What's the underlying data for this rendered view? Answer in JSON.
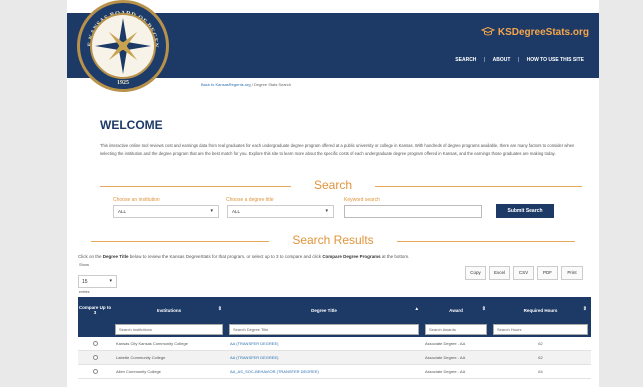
{
  "brand": {
    "name": "KSDegreeStats.org",
    "accent": "#f5a64a",
    "navy": "#1d3a67"
  },
  "seal": {
    "top_text": "THE KANSAS BOARD OF REGENTS",
    "year": "1925",
    "icon": "compass-star-icon"
  },
  "nav": {
    "search": "SEARCH",
    "about": "ABOUT",
    "how": "HOW TO USE THIS SITE",
    "sep": "|"
  },
  "breadcrumb": {
    "home": "Back to KansasRegents.org",
    "sep": "/",
    "current": "Degree Stats Search"
  },
  "welcome": {
    "title": "WELCOME",
    "intro": "This interactive online tool reviews cost and earnings data from real graduates for each undergraduate degree program offered at a public university or college in Kansas. With hundreds of degree programs available, there are many factors to consider when selecting the institution and the degree program that are the best match for you. Explore this site to learn more about the specific costs of each undergraduate degree program offered in Kansas, and the earnings those graduates are making today."
  },
  "search": {
    "title": "Search",
    "institution_label": "Choose an institution",
    "institution_value": "ALL",
    "degree_label": "Choose a degree title",
    "degree_value": "ALL",
    "keyword_label": "Keyword search",
    "keyword_value": "",
    "submit": "Submit Search"
  },
  "results": {
    "title": "Search Results",
    "help_pre": "Click on the ",
    "help_bold1": "Degree Title",
    "help_mid": " below to review the Kansas DegreeStats for that program, or select up to 3 to compare and click ",
    "help_bold2": "Compare Degree Programs",
    "help_post": " at the bottom.",
    "show_label": "Show",
    "entries_value": "15",
    "entries_label": "entries",
    "buttons": [
      "Copy",
      "Excel",
      "CSV",
      "PDF",
      "Print"
    ]
  },
  "table": {
    "columns": [
      {
        "label": "Compare Up to 3"
      },
      {
        "label": "Institutions"
      },
      {
        "label": "Degree Title"
      },
      {
        "label": "Award"
      },
      {
        "label": "Required Hours"
      }
    ],
    "filters": [
      "Search Institutions",
      "Search Degree Title",
      "Search Awards",
      "Search Hours"
    ],
    "rows": [
      {
        "institution": "Kansas City Kansas Community College",
        "degree": "AA (TRANSFER DEGREE)",
        "award": "Associate Degree - AA",
        "hours": "62"
      },
      {
        "institution": "Labette Community College",
        "degree": "AA (TRANSFER DEGREE)",
        "award": "Associate Degree - AA",
        "hours": "62"
      },
      {
        "institution": "Allen Community College",
        "degree": "AA_AS_SOC-BEHAVIOR (TRANSFER DEGREE)",
        "award": "Associate Degree - AA",
        "hours": "64"
      }
    ]
  }
}
